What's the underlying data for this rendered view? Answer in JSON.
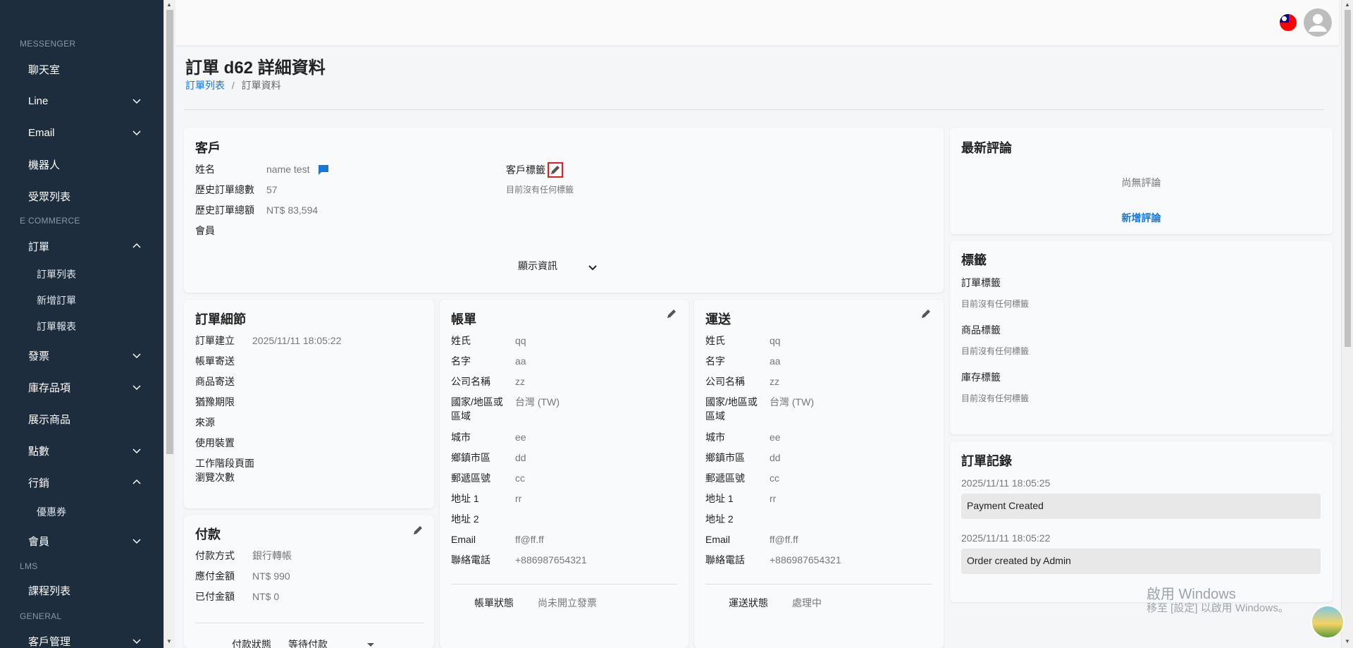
{
  "sidebar": {
    "sections": {
      "messenger": "MESSENGER",
      "ecommerce": "E COMMERCE",
      "lms": "LMS",
      "general": "GENERAL"
    },
    "items": {
      "chatroom": "聊天室",
      "line": "Line",
      "email": "Email",
      "robot": "機器人",
      "audience": "受眾列表",
      "orders": "訂單",
      "order_list": "訂單列表",
      "new_order": "新增訂單",
      "order_report": "訂單報表",
      "invoice": "發票",
      "inventory": "庫存品項",
      "display_products": "展示商品",
      "points": "點數",
      "marketing": "行銷",
      "coupon": "優惠券",
      "member": "會員",
      "courses": "課程列表",
      "customer_mgmt": "客戶管理"
    }
  },
  "page": {
    "title": "訂單 d62 詳細資料",
    "breadcrumb": {
      "parent": "訂單列表",
      "sep": "/",
      "current": "訂單資料"
    }
  },
  "customer": {
    "title": "客戶",
    "name_label": "姓名",
    "name_value": "name test",
    "history_count_label": "歷史訂單總數",
    "history_count_value": "57",
    "history_total_label": "歷史訂單總額",
    "history_total_value": "NT$ 83,594",
    "member_label": "會員",
    "tags_label": "客戶標籤",
    "tags_empty": "目前沒有任何標籤",
    "show_info": "顯示資訊"
  },
  "order_detail": {
    "title": "訂單細節",
    "created_label": "訂單建立",
    "created_value": "2025/11/11 18:05:22",
    "bill_sent": "帳單寄送",
    "goods_sent": "商品寄送",
    "grace": "猶豫期限",
    "source": "來源",
    "device": "使用裝置",
    "session_views_1": "工作階段頁面",
    "session_views_2": "瀏覽次數"
  },
  "billing": {
    "title": "帳單",
    "rows": [
      {
        "label": "姓氏",
        "value": "qq"
      },
      {
        "label": "名字",
        "value": "aa"
      },
      {
        "label": "公司名稱",
        "value": "zz"
      },
      {
        "label": "國家/地區或",
        "label2": "區域",
        "value": "台灣 (TW)"
      },
      {
        "label": "城市",
        "value": "ee"
      },
      {
        "label": "鄉鎮市區",
        "value": "dd"
      },
      {
        "label": "郵遞區號",
        "value": "cc"
      },
      {
        "label": "地址 1",
        "value": "rr"
      },
      {
        "label": "地址 2",
        "value": ""
      },
      {
        "label": "Email",
        "value": "ff@ff.ff"
      },
      {
        "label": "聯絡電話",
        "value": "+886987654321"
      }
    ],
    "status_label": "帳單狀態",
    "status_value": "尚未開立發票"
  },
  "shipping": {
    "title": "運送",
    "rows": [
      {
        "label": "姓氏",
        "value": "qq"
      },
      {
        "label": "名字",
        "value": "aa"
      },
      {
        "label": "公司名稱",
        "value": "zz"
      },
      {
        "label": "國家/地區或",
        "label2": "區域",
        "value": "台灣 (TW)"
      },
      {
        "label": "城市",
        "value": "ee"
      },
      {
        "label": "鄉鎮市區",
        "value": "dd"
      },
      {
        "label": "郵遞區號",
        "value": "cc"
      },
      {
        "label": "地址 1",
        "value": "rr"
      },
      {
        "label": "地址 2",
        "value": ""
      },
      {
        "label": "Email",
        "value": "ff@ff.ff"
      },
      {
        "label": "聯絡電話",
        "value": "+886987654321"
      }
    ],
    "status_label": "運送狀態",
    "status_value": "處理中"
  },
  "payment": {
    "title": "付款",
    "method_label": "付款方式",
    "method_value": "銀行轉帳",
    "due_label": "應付金額",
    "due_value": "NT$ 990",
    "paid_label": "已付金額",
    "paid_value": "NT$ 0",
    "status_label": "付款狀態",
    "status_value": "等待付款"
  },
  "reviews": {
    "title": "最新評論",
    "empty": "尚無評論",
    "add": "新增評論"
  },
  "tags": {
    "title": "標籤",
    "order_tags": "訂單標籤",
    "product_tags": "商品標籤",
    "stock_tags": "庫存標籤",
    "empty": "目前沒有任何標籤"
  },
  "history": {
    "title": "訂單記錄",
    "entries": [
      {
        "time": "2025/11/11 18:05:25",
        "text": "Payment Created"
      },
      {
        "time": "2025/11/11 18:05:22",
        "text": "Order created by Admin"
      }
    ]
  },
  "watermark": {
    "line1": "啟用 Windows",
    "line2": "移至 [設定] 以啟用 Windows。"
  },
  "colors": {
    "sidebar": "#1e2d3d",
    "accent": "#1976d2",
    "highlight": "#e02020"
  }
}
